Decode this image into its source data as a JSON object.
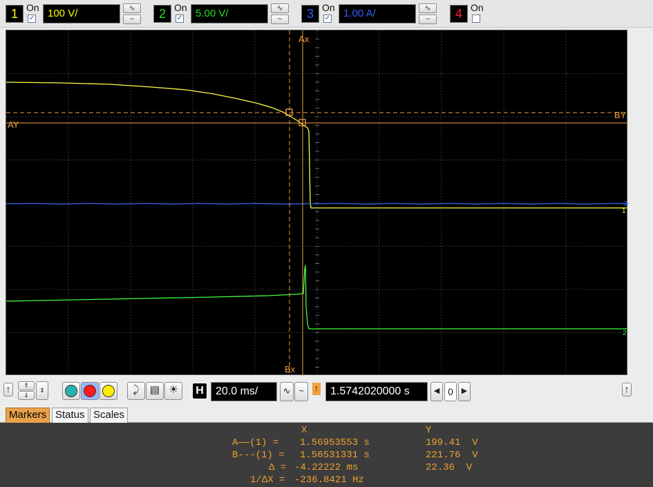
{
  "channels": [
    {
      "num": "1",
      "on_label": "On",
      "checked": true,
      "scale": "100 V/",
      "color": "#ffff00",
      "num_color": "#ffff00",
      "wave_up": "∿",
      "wave_down": "~"
    },
    {
      "num": "2",
      "on_label": "On",
      "checked": true,
      "scale": "5.00 V/",
      "color": "#22e022",
      "num_color": "#22e022",
      "wave_up": "∿",
      "wave_down": "~"
    },
    {
      "num": "3",
      "on_label": "On",
      "checked": true,
      "scale": "1.00 A/",
      "color": "#3060ff",
      "num_color": "#3060ff",
      "wave_up": "∿",
      "wave_down": "~"
    },
    {
      "num": "4",
      "on_label": "On",
      "checked": false,
      "scale": "",
      "color": "#ff2030",
      "num_color": "#ff2030"
    }
  ],
  "screen": {
    "cursor_labels": {
      "ax": "Ax",
      "bx": "Bx",
      "ay": "AY",
      "by": "BY"
    },
    "ground_labels": {
      "ch1": "1",
      "ch2": "2",
      "ch3": "3"
    },
    "cursor_color": "#f0a040",
    "trace_colors": {
      "ch1": "#ffff40",
      "ch2": "#40ff40",
      "ch3": "#2f5fe0"
    }
  },
  "toolbar": {
    "timebase": "20.0 ms/",
    "position": "1.5742020000 s",
    "h_label": "H",
    "step_value": "0",
    "marker_colors": [
      "#28b0b0",
      "#ff1a1a",
      "#ffee00"
    ]
  },
  "tabs": [
    {
      "label": "Markers",
      "active": true
    },
    {
      "label": "Status",
      "active": false
    },
    {
      "label": "Scales",
      "active": false
    }
  ],
  "markers": {
    "header_x": "X",
    "header_y": "Y",
    "rows": [
      {
        "label": "A——(1) =",
        "x": "1.56953553 s",
        "y": "199.41  V"
      },
      {
        "label": "B---(1) =",
        "x": "1.56531331 s",
        "y": "221.76  V"
      },
      {
        "label": "Δ =",
        "x": "-4.22222 ms",
        "y": "22.36  V"
      },
      {
        "label": "1/ΔX =",
        "x": "-236.8421 Hz",
        "y": ""
      }
    ]
  }
}
